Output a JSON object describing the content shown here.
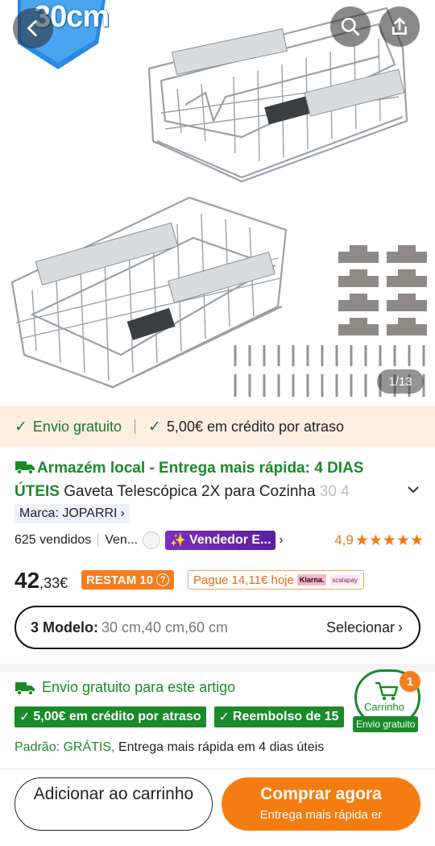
{
  "hero": {
    "size_badge": "30cm",
    "image_counter": "1/13",
    "back_icon": "chevron-left-icon",
    "search_icon": "search-icon",
    "share_icon": "share-icon"
  },
  "benefits": {
    "free_shipping": "Envio gratuito",
    "delay_credit": "5,00€ em crédito por atraso"
  },
  "product": {
    "local_warehouse": "Armazém local - Entrega mais rápida: 4 DIAS ÚTEIS",
    "title": "Gaveta Telescópica 2X para Cozinha",
    "title_fade": "30 4",
    "brand": "Marca: JOPARRI",
    "sold": "625 vendidos",
    "seller_short": "Ven...",
    "seller_badge": "Vendedor E...",
    "rating": "4,9",
    "stars": "★★★★★",
    "price_int": "42",
    "price_dec": ",33€",
    "remaining": "RESTAM 10",
    "klarna_text": "Pague 14,11€ hoje",
    "klarna_logo": "Klarna.",
    "scalapay_logo": "scalapay"
  },
  "model": {
    "label": "3 Modelo:",
    "values": "30 cm,40 cm,60 cm",
    "select": "Selecionar"
  },
  "shipping": {
    "title": "Envio gratuito para este artigo",
    "chip1": "5,00€ em crédito por atraso",
    "chip2": "Reembolso de 15",
    "standard_label": "Padrão: GRÁTIS,",
    "standard_text": "Entrega mais rápida em 4 dias úteis"
  },
  "cart": {
    "label": "Carrinho",
    "count": "1",
    "free": "Envio gratuito"
  },
  "actions": {
    "add_to_cart": "Adicionar ao carrinho",
    "buy_now": "Comprar agora",
    "buy_now_sub": "Entrega mais rápida er"
  },
  "colors": {
    "accent": "#f57c10",
    "green": "#1a8a2a",
    "purple": "#6a24b0"
  }
}
